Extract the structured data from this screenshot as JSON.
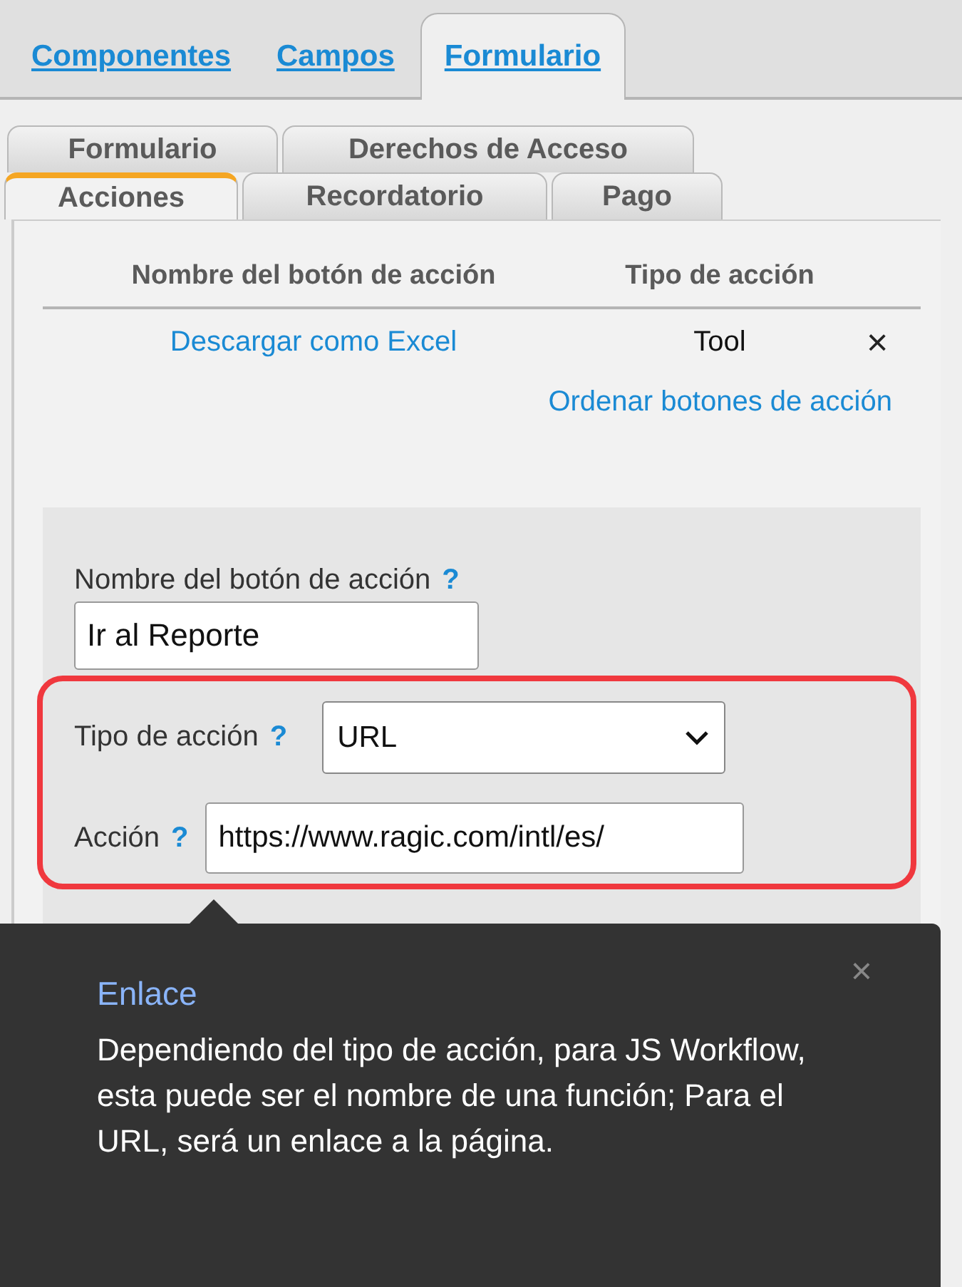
{
  "top_tabs": [
    {
      "label": "Componentes",
      "selected": false
    },
    {
      "label": "Campos",
      "selected": false
    },
    {
      "label": "Formulario",
      "selected": true
    }
  ],
  "sub_tabs": [
    [
      {
        "label": "Formulario",
        "selected": false
      },
      {
        "label": "Derechos de Acceso",
        "selected": false
      }
    ],
    [
      {
        "label": "Acciones",
        "selected": true
      },
      {
        "label": "Recordatorio",
        "selected": false
      },
      {
        "label": "Pago",
        "selected": false
      }
    ]
  ],
  "table": {
    "columns": [
      "Nombre del botón de acción",
      "Tipo de acción"
    ],
    "rows": [
      {
        "name": "Descargar como Excel",
        "type": "Tool",
        "delete": "×"
      }
    ]
  },
  "sort_link": "Ordenar botones de acción",
  "form": {
    "name_label": "Nombre del botón de acción",
    "name_help": "?",
    "name_value": "Ir al Reporte",
    "type_label": "Tipo de acción",
    "type_help": "?",
    "type_value": "URL",
    "action_label": "Acción",
    "action_help": "?",
    "action_value": "https://www.ragic.com/intl/es/"
  },
  "tooltip": {
    "close": "×",
    "title": "Enlace",
    "text": "Dependiendo del tipo de acción, para JS Workflow, esta puede ser el nombre de una función; Para el URL, será un enlace a la página."
  }
}
